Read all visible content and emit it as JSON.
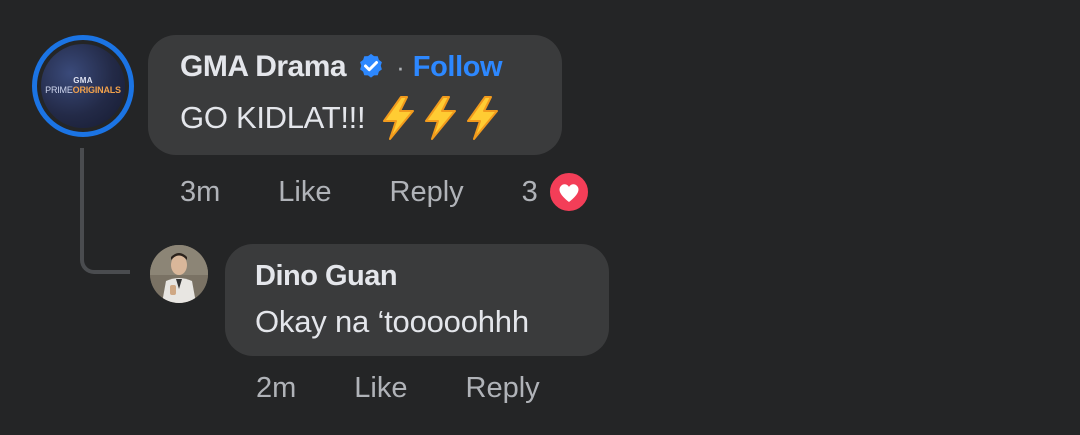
{
  "comment": {
    "author": "GMA Drama",
    "verified_icon": "verified-badge-icon",
    "follow_label": "Follow",
    "separator": "·",
    "text": "GO KIDLAT!!!",
    "emoji": [
      "lightning-bolt-icon",
      "lightning-bolt-icon",
      "lightning-bolt-icon"
    ],
    "avatar": {
      "brand": "GMA",
      "line1": "PRIME",
      "line2": "ORIGINALS"
    },
    "time": "3m",
    "like_label": "Like",
    "reply_label": "Reply",
    "reaction_count": "3",
    "reaction_icon": "heart-reaction-icon"
  },
  "reply": {
    "author": "Dino Guan",
    "text": "Okay na ‘tooooohhh",
    "time": "2m",
    "like_label": "Like",
    "reply_label": "Reply"
  },
  "colors": {
    "background": "#242526",
    "bubble": "#3a3b3c",
    "follow": "#2d88ff",
    "avatar_ring": "#1b74e4",
    "heart": "#f33e58",
    "bolt": "#ffcc33"
  }
}
